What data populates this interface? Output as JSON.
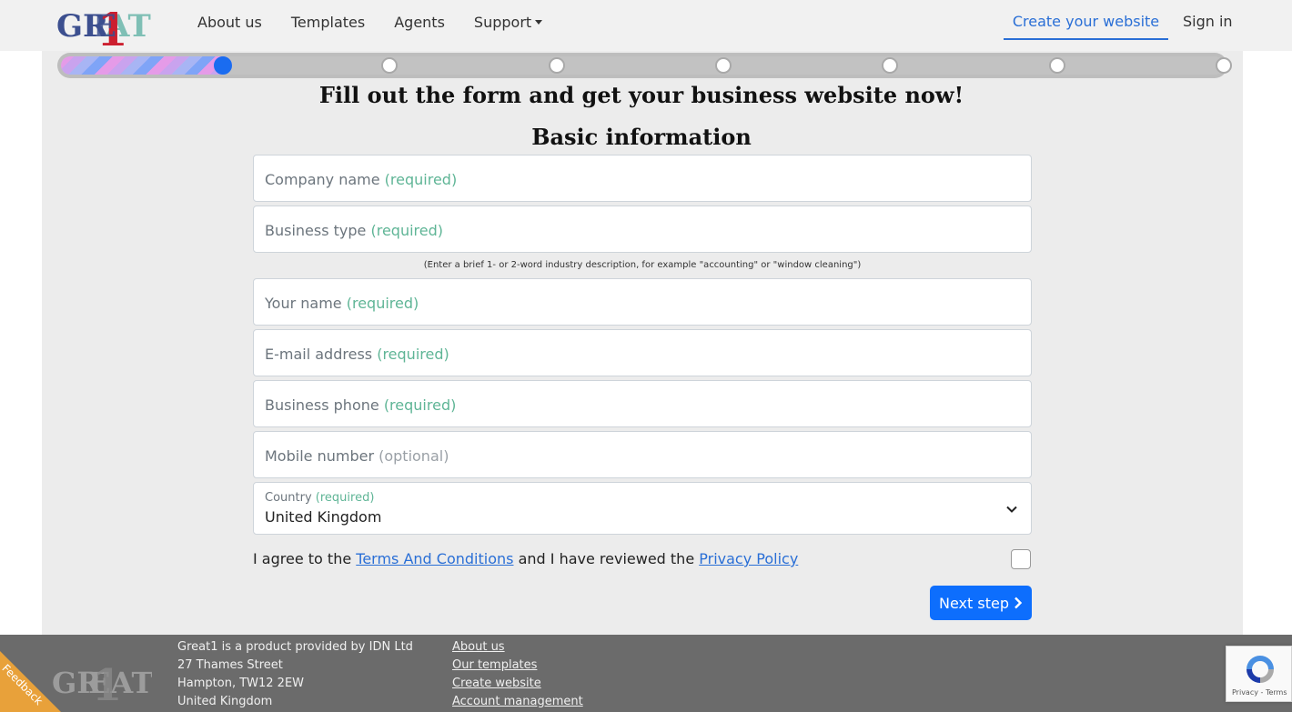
{
  "header": {
    "logo_text": "GREAT1",
    "nav": [
      "About us",
      "Templates",
      "Agents",
      "Support"
    ],
    "create_website": "Create your website",
    "sign_in": "Sign in"
  },
  "progress": {
    "current_step": 1,
    "total_steps": 8
  },
  "form": {
    "title": "Fill out the form and get your business website now!",
    "section": "Basic information",
    "fields": [
      {
        "label": "Company name",
        "note": "(required)"
      },
      {
        "label": "Business type",
        "note": "(required)"
      },
      {
        "label": "Your name",
        "note": "(required)"
      },
      {
        "label": "E-mail address",
        "note": "(required)"
      },
      {
        "label": "Business phone",
        "note": "(required)"
      },
      {
        "label": "Mobile number",
        "note": "(optional)"
      }
    ],
    "business_type_hint": "(Enter a brief 1- or 2-word industry description, for example \"accounting\" or \"window cleaning\")",
    "country": {
      "label": "Country",
      "note": "(required)",
      "value": "United Kingdom"
    },
    "agree": {
      "prefix": "I agree to the ",
      "terms": "Terms And Conditions",
      "middle": " and I have reviewed the ",
      "privacy": "Privacy Policy"
    },
    "next_button": "Next step"
  },
  "footer": {
    "address": [
      "Great1 is a product provided by IDN Ltd",
      "27 Thames Street",
      "Hampton, TW12 2EW",
      "United Kingdom"
    ],
    "links": [
      "About us",
      "Our templates",
      "Create website",
      "Account management"
    ],
    "feedback": "Feedback",
    "recaptcha": "Privacy - Terms"
  },
  "colors": {
    "accent": "#0d6efd",
    "required": "#5fb596",
    "footer_bg": "#6b6b6b",
    "feedback": "#e8a13a"
  }
}
